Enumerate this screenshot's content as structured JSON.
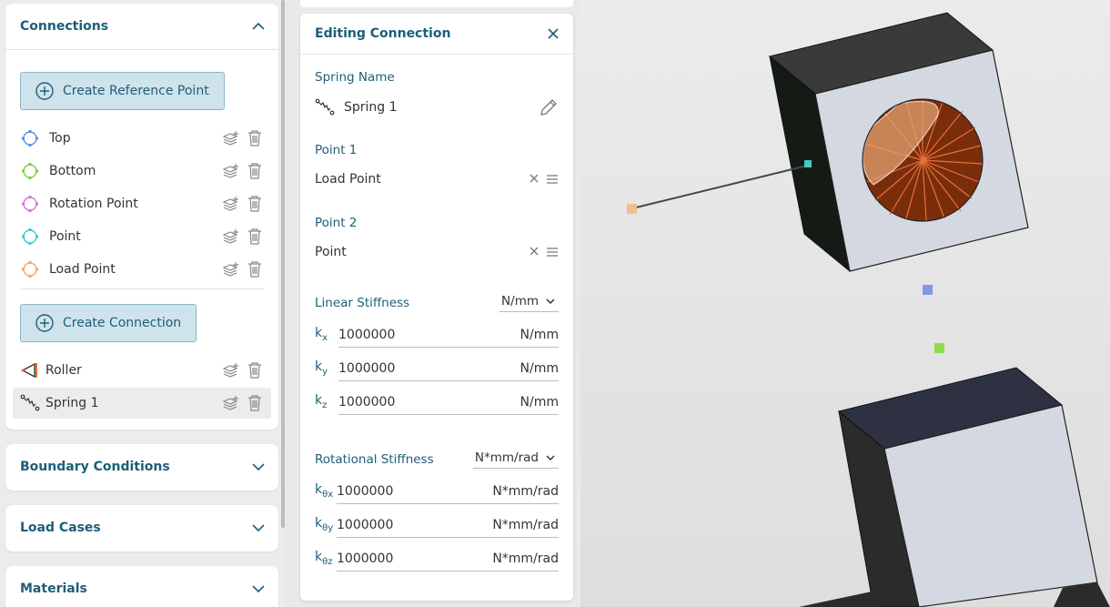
{
  "sidebar": {
    "connections": {
      "title": "Connections",
      "create_ref_label": "Create Reference Point",
      "ref_points": [
        {
          "label": "Top",
          "color": "#5b8def"
        },
        {
          "label": "Bottom",
          "color": "#7bd13f"
        },
        {
          "label": "Rotation Point",
          "color": "#e070d6"
        },
        {
          "label": "Point",
          "color": "#3ccdc4"
        },
        {
          "label": "Load Point",
          "color": "#f0a860"
        }
      ],
      "create_conn_label": "Create Connection",
      "connections_list": [
        {
          "label": "Roller",
          "icon": "roller-icon"
        },
        {
          "label": "Spring 1",
          "icon": "spring-icon"
        }
      ]
    },
    "boundary_conditions": {
      "title": "Boundary Conditions"
    },
    "load_cases": {
      "title": "Load Cases"
    },
    "materials": {
      "title": "Materials"
    }
  },
  "editor": {
    "title": "Editing Connection",
    "spring_name_label": "Spring Name",
    "spring_name": "Spring 1",
    "point1_label": "Point 1",
    "point1_value": "Load Point",
    "point2_label": "Point 2",
    "point2_value": "Point",
    "linear": {
      "label": "Linear Stiffness",
      "unit_select": "N/mm",
      "rows": [
        {
          "sym": "k",
          "sub": "x",
          "value": "1000000",
          "unit": "N/mm"
        },
        {
          "sym": "k",
          "sub": "y",
          "value": "1000000",
          "unit": "N/mm"
        },
        {
          "sym": "k",
          "sub": "z",
          "value": "1000000",
          "unit": "N/mm"
        }
      ]
    },
    "rotational": {
      "label": "Rotational Stiffness",
      "unit_select": "N*mm/rad",
      "rows": [
        {
          "sym": "k",
          "sub": "θx",
          "value": "1000000",
          "unit": "N*mm/rad"
        },
        {
          "sym": "k",
          "sub": "θy",
          "value": "1000000",
          "unit": "N*mm/rad"
        },
        {
          "sym": "k",
          "sub": "θz",
          "value": "1000000",
          "unit": "N*mm/rad"
        }
      ]
    }
  },
  "colors": {
    "accent": "#1d5e78",
    "button_bg": "#cfe3ec",
    "orange_marker": "#f0c08a",
    "blue_marker": "#7d9ae6",
    "green_marker": "#8fdc4e",
    "cyan_marker": "#3ccdc4"
  }
}
